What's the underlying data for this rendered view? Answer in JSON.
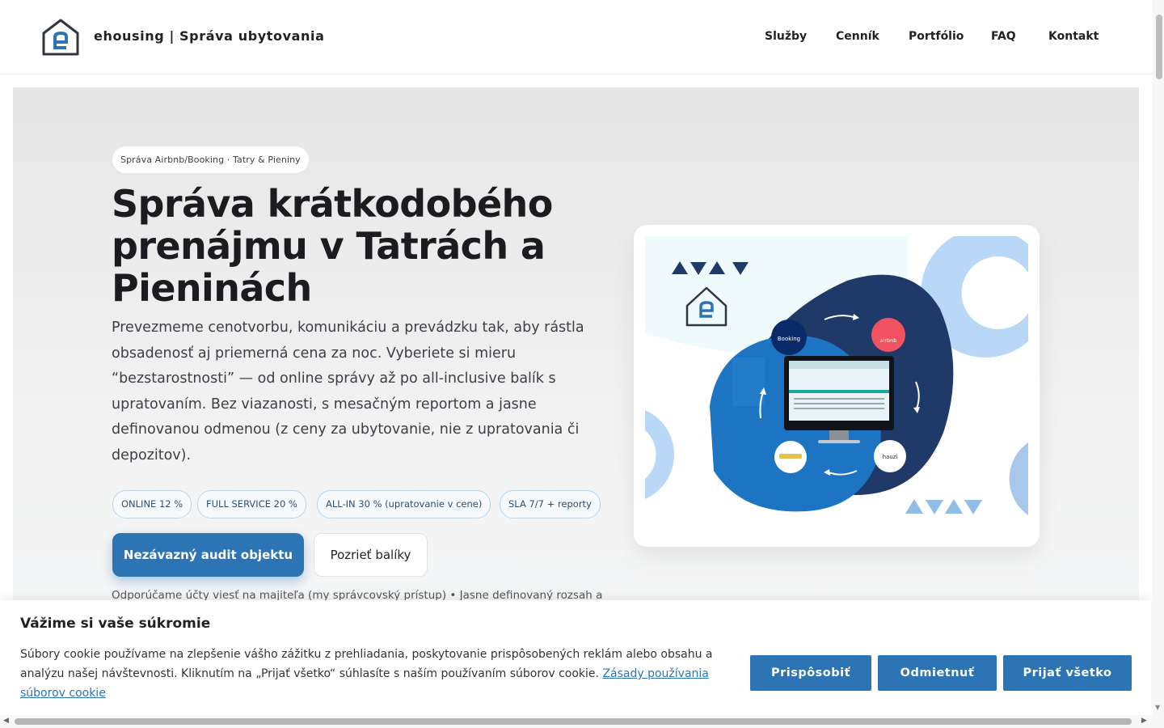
{
  "header": {
    "brand": "ehousing | Správa ubytovania",
    "nav": [
      "Služby",
      "Cenník",
      "Portfólio",
      "FAQ",
      "Kontakt"
    ]
  },
  "hero": {
    "badge": "Správa Airbnb/Booking · Tatry & Pieniny",
    "title": "Správa krátkodobého prenájmu v Tatrách a Pieninách",
    "lead": "Prevezmeme cenotvorbu, komunikáciu a prevádzku tak, aby rástla obsadenosť aj priemerná cena za noc. Vyberiete si mieru “bezstarostnosti” — od online správy až po all-inclusive balík s upratovaním. Bez viazanosti, s mesačným reportom a jasne definovanou odmenou (z ceny za ubytovanie, nie z upratovania či depozitov).",
    "chips": [
      "ONLINE 12 %",
      "FULL SERVICE 20 %",
      "ALL-IN 30 % (upratovanie v cene)",
      "SLA 7/7 + reporty"
    ],
    "primary_cta": "Nezávazný audit objektu",
    "secondary_cta": "Pozrieť balíky",
    "footnote": "Odporúčame účty viesť na majiteľa (my správcovský prístup) • Jasne definovaný rozsah a"
  },
  "illustration": {
    "labels": [
      "Booking",
      "airbnb",
      "hauzi"
    ]
  },
  "cookie": {
    "title": "Vážime si vaše súkromie",
    "text": "Súbory cookie používame na zlepšenie vášho zážitku z prehliadania, poskytovanie prispôsobených reklám alebo obsahu a analýzu našej návštevnosti. Kliknutím na „Prijať všetko“ súhlasíte s naším používaním súborov cookie.",
    "link": "Zásady používania súborov cookie",
    "buttons": [
      "Prispôsobiť",
      "Odmietnuť",
      "Prijať všetko"
    ]
  },
  "colors": {
    "accent": "#2c74b4",
    "navy": "#1f3a68",
    "light_blue": "#b9d8f7"
  }
}
